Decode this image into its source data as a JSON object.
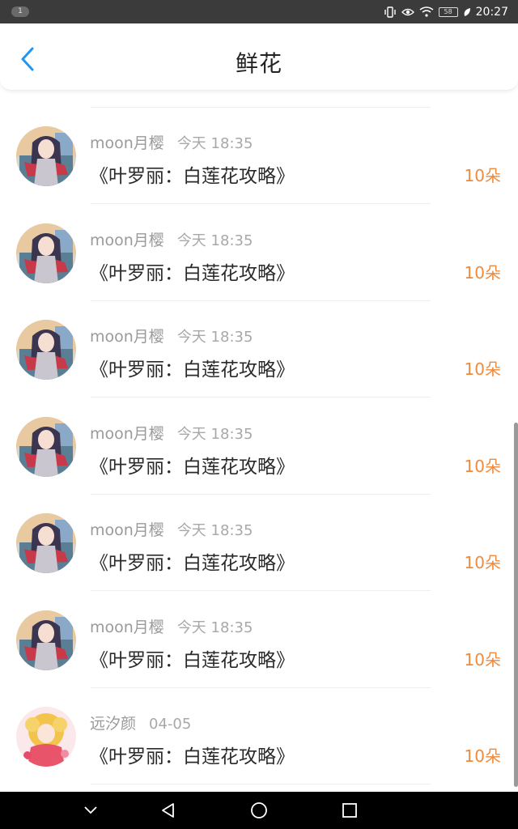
{
  "status_bar": {
    "badge": "1",
    "battery": "58",
    "time": "20:27"
  },
  "header": {
    "title": "鲜花"
  },
  "list": {
    "items": [
      {
        "name": "moon月樱",
        "time": "今天 18:35",
        "title": "《叶罗丽：白莲花攻略》",
        "count": "10朵",
        "avatar": "avatar-girl-red-scarf"
      },
      {
        "name": "moon月樱",
        "time": "今天 18:35",
        "title": "《叶罗丽：白莲花攻略》",
        "count": "10朵",
        "avatar": "avatar-girl-red-scarf"
      },
      {
        "name": "moon月樱",
        "time": "今天 18:35",
        "title": "《叶罗丽：白莲花攻略》",
        "count": "10朵",
        "avatar": "avatar-girl-red-scarf"
      },
      {
        "name": "moon月樱",
        "time": "今天 18:35",
        "title": "《叶罗丽：白莲花攻略》",
        "count": "10朵",
        "avatar": "avatar-girl-red-scarf"
      },
      {
        "name": "moon月樱",
        "time": "今天 18:35",
        "title": "《叶罗丽：白莲花攻略》",
        "count": "10朵",
        "avatar": "avatar-girl-red-scarf"
      },
      {
        "name": "moon月樱",
        "time": "今天 18:35",
        "title": "《叶罗丽：白莲花攻略》",
        "count": "10朵",
        "avatar": "avatar-girl-red-scarf"
      },
      {
        "name": "远汐颜",
        "time": "04-05",
        "title": "《叶罗丽：白莲花攻略》",
        "count": "10朵",
        "avatar": "avatar-girl-blonde"
      }
    ]
  },
  "colors": {
    "accent_blue": "#2196f3",
    "count_orange": "#f08a3c"
  },
  "nav_bar": {
    "icons": [
      "chevron-down-icon",
      "back-triangle-icon",
      "home-circle-icon",
      "recents-square-icon"
    ]
  }
}
